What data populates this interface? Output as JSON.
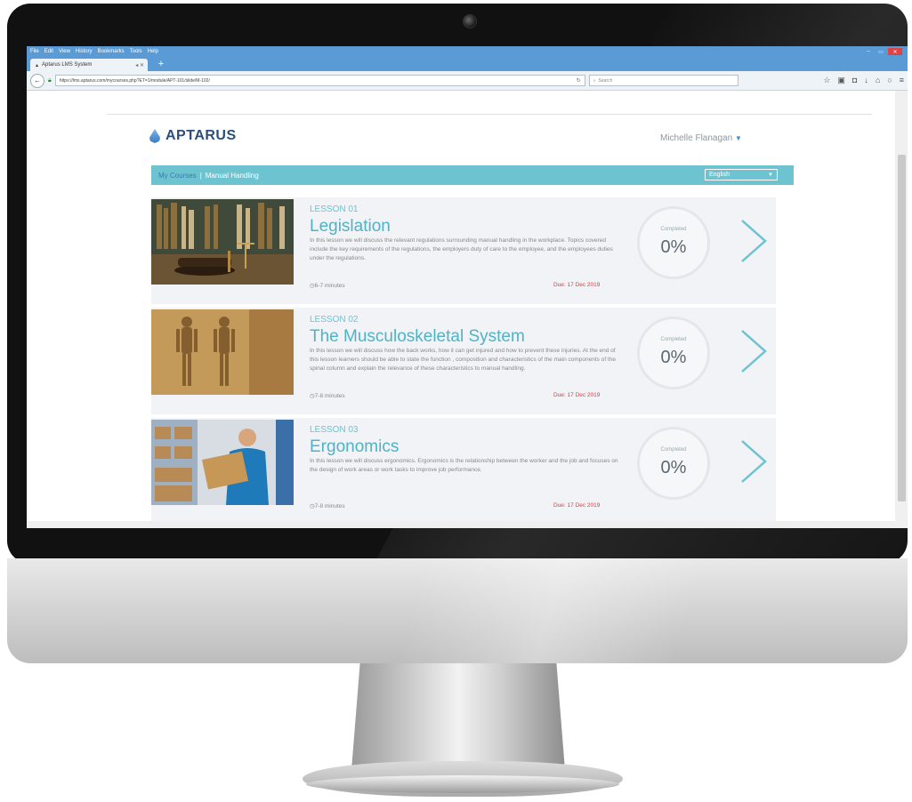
{
  "browser": {
    "menu": [
      "File",
      "Edit",
      "View",
      "History",
      "Bookmarks",
      "Tools",
      "Help"
    ],
    "tab_title": "Aptarus LMS System",
    "url": "https://lms.aptarus.com/mycourses.php?ET=1/module/APT-101/slide/M-102/",
    "search_placeholder": "Search"
  },
  "app": {
    "logo_text": "APTARUS",
    "user_name": "Michelle Flanagan",
    "breadcrumb": [
      "My Courses",
      "Manual Handling"
    ],
    "language": "English",
    "accent_color": "#6ec3d0"
  },
  "lessons": [
    {
      "number": "LESSON 01",
      "title": "Legislation",
      "description": "In this lesson we will discuss the relevant regulations surrounding manual handling in the workplace. Topics covered include the key requirements of the regulations, the employers duty of care to the employee, and the employees duties under the regulations.",
      "duration": "6-7 minutes",
      "due": "Due: 17 Dec 2019",
      "status_label": "Completed",
      "progress": "0%"
    },
    {
      "number": "LESSON 02",
      "title": "The Musculoskeletal System",
      "description": "In this lesson we will discuss how the back works, how it can get injured and how to prevent these injuries. At the end of this lesson learners should be able to state the function , composition and characteristics of the main components of the spinal column and explain the relevance of these characteristics to manual handling.",
      "duration": "7-8 minutes",
      "due": "Due: 17 Dec 2019",
      "status_label": "Completed",
      "progress": "0%"
    },
    {
      "number": "LESSON 03",
      "title": "Ergonomics",
      "description": "In this lesson we will discuss ergonomics. Ergonomics is the relationship between the worker and the job and focuses on the design of work areas or work tasks to improve job performance.",
      "duration": "7-8 minutes",
      "due": "Due: 17 Dec 2019",
      "status_label": "Completed",
      "progress": "0%"
    }
  ]
}
